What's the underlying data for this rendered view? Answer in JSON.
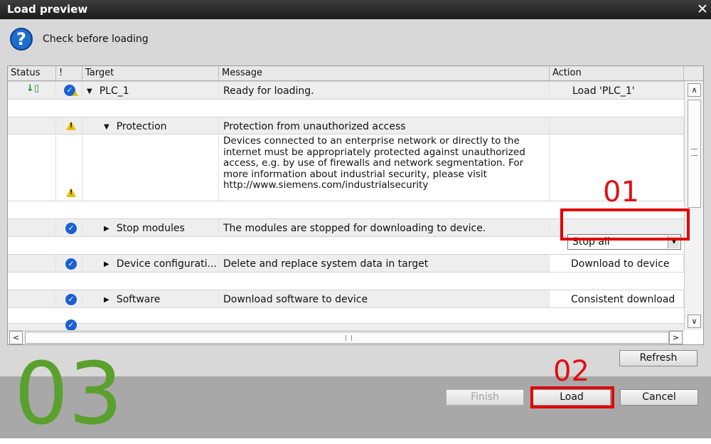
{
  "window": {
    "title": "Load preview",
    "close_glyph": "✕"
  },
  "header": {
    "icon": "question-icon",
    "text": "Check before loading"
  },
  "table": {
    "columns": [
      "Status",
      "!",
      "Target",
      "Message",
      "Action"
    ],
    "rows": {
      "plc": {
        "target": "PLC_1",
        "message": "Ready for loading.",
        "action": "Load 'PLC_1'",
        "expand": "▼"
      },
      "protection": {
        "target": "Protection",
        "message": "Protection from unauthorized access",
        "expand": "▼"
      },
      "protection_detail": {
        "lines": [
          "Devices connected to an enterprise network or directly to the",
          "internet must be appropriately protected against unauthorized",
          "access, e.g. by use of firewalls and network segmentation. For",
          "more information about industrial security, please visit",
          "http://www.siemens.com/industrialsecurity"
        ]
      },
      "stop": {
        "target": "Stop modules",
        "message": "The modules are stopped for downloading to device.",
        "action": "Stop all",
        "expand": "▶"
      },
      "devcfg": {
        "target": "Device configurati...",
        "message": "Delete and replace system data in target",
        "action": "Download to device",
        "expand": "▶"
      },
      "software": {
        "target": "Software",
        "message": "Download software to device",
        "action": "Consistent download",
        "expand": "▶"
      }
    }
  },
  "buttons": {
    "refresh": "Refresh",
    "finish": "Finish",
    "load": "Load",
    "cancel": "Cancel"
  },
  "annotations": {
    "a01": "01",
    "a02": "02",
    "a03": "03"
  },
  "colors": {
    "accent_red": "#e00000",
    "annotation_green": "#5aa02c",
    "check_blue": "#1a5fd4"
  }
}
